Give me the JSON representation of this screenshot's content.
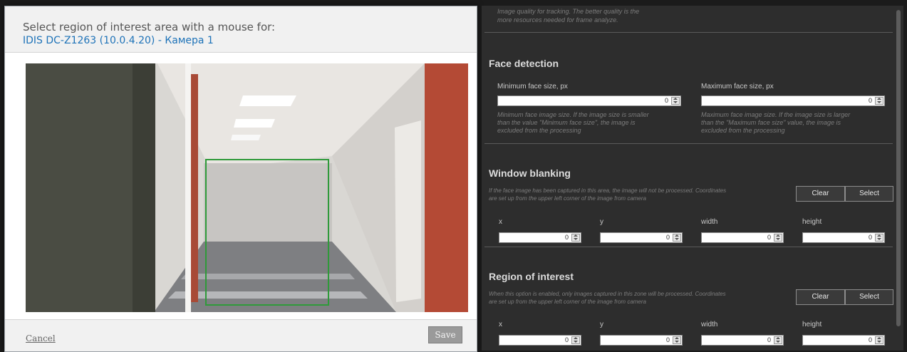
{
  "dialog": {
    "title": "Select region of interest area with a mouse for:",
    "camera_name": "IDIS DC-Z1263 (10.0.4.20) - Камера 1",
    "cancel_label": "Cancel",
    "save_label": "Save"
  },
  "panel": {
    "quality_hint_line1": "Image quality for tracking. The better quality is the",
    "quality_hint_line2": "more resources needed for frame analyze.",
    "face_detection": {
      "title": "Face detection",
      "min_label": "Minimum face size, px",
      "min_value": "0",
      "min_hint_1": "Minimum face image size. If the image size is smaller",
      "min_hint_2": "than the value \"Minimum face size\", the image is",
      "min_hint_3": "excluded from the processing",
      "max_label": "Maximum face size, px",
      "max_value": "0",
      "max_hint_1": "Maximum face image size. If the image size is larger",
      "max_hint_2": "than the \"Maximum face size\" value, the image is",
      "max_hint_3": "excluded from the processing"
    },
    "window_blanking": {
      "title": "Window blanking",
      "hint_1": "If the face image has been captured in this area, the image will not be processed. Coordinates",
      "hint_2": "are set up from the upper left corner of the image from camera",
      "clear_label": "Clear",
      "select_label": "Select",
      "x_label": "x",
      "x_value": "0",
      "y_label": "y",
      "y_value": "0",
      "width_label": "width",
      "width_value": "0",
      "height_label": "height",
      "height_value": "0"
    },
    "region_of_interest": {
      "title": "Region of interest",
      "hint_1": "When this option is enabled, only images captured in this zone will be processed. Coordinates",
      "hint_2": "are set up from the upper left corner of the image from camera",
      "clear_label": "Clear",
      "select_label": "Select",
      "x_label": "x",
      "x_value": "0",
      "y_label": "y",
      "y_value": "0",
      "width_label": "width",
      "width_value": "0",
      "height_label": "height",
      "height_value": "0"
    }
  },
  "colors": {
    "link_blue": "#1d72b8",
    "roi_green": "#2f9a3a",
    "panel_bg": "#2d2d2d"
  }
}
